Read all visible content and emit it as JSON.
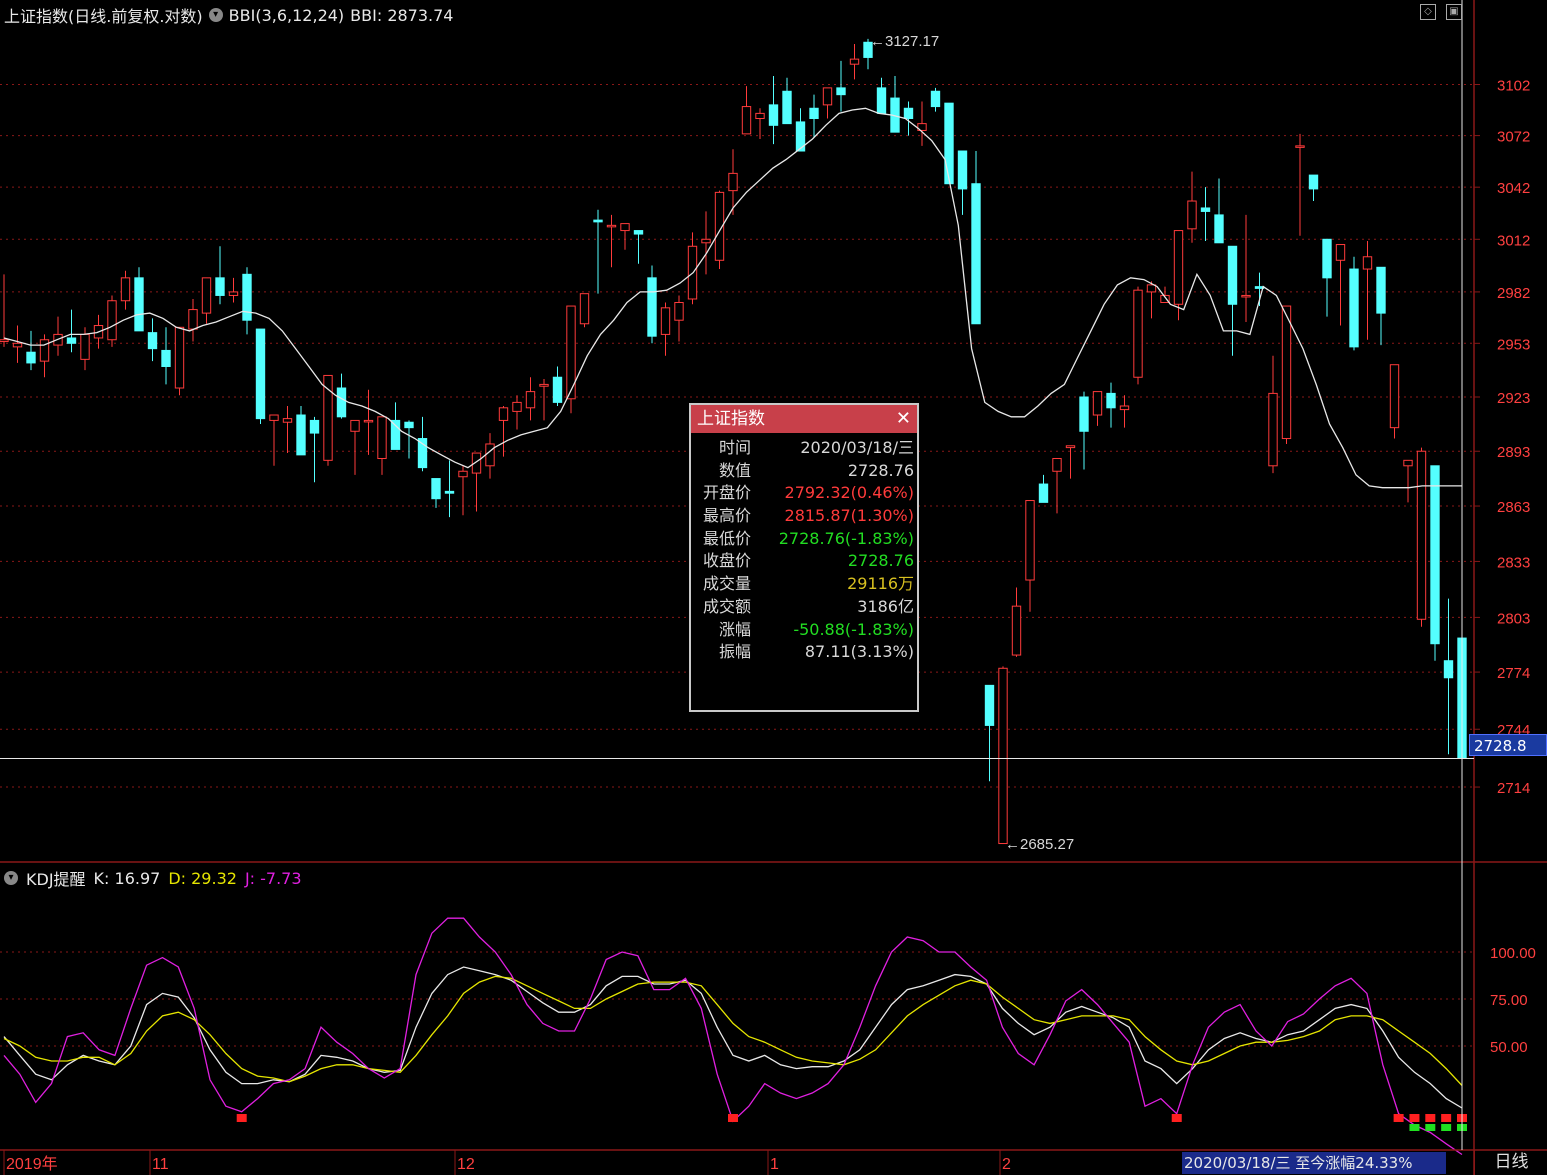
{
  "header": {
    "title": "上证指数(日线.前复权.对数)",
    "indicator_name": "BBI(3,6,12,24)",
    "indicator_value": "BBI: 2873.74"
  },
  "kdj_header": {
    "name": "KDJ提醒",
    "k": "K: 16.97",
    "d": "D: 29.32",
    "j": "J: -7.73"
  },
  "price_axis": {
    "labels": [
      "3102",
      "3072",
      "3042",
      "3012",
      "2982",
      "2953",
      "2923",
      "2893",
      "2863",
      "2833",
      "2803",
      "2774",
      "2744",
      "2714"
    ],
    "current_price": "2728.8"
  },
  "kdj_axis": {
    "labels": [
      "100.00",
      "75.00",
      "50.00"
    ]
  },
  "annotations": {
    "high": "3127.17",
    "low": "2685.27"
  },
  "date_axis": {
    "labels": [
      "2019年",
      "11",
      "12",
      "1",
      "2"
    ]
  },
  "status_bar": {
    "range_text": "2020/03/18/三  至今涨幅24.33%",
    "period_tab": "日线"
  },
  "popup": {
    "title": "上证指数",
    "rows": [
      {
        "label": "时间",
        "value": "2020/03/18/三",
        "color": "#d8d8d8"
      },
      {
        "label": "数值",
        "value": "2728.76",
        "color": "#d8d8d8"
      },
      {
        "label": "开盘价",
        "value": "2792.32(0.46%)",
        "color": "#ff3b3b"
      },
      {
        "label": "最高价",
        "value": "2815.87(1.30%)",
        "color": "#ff3b3b"
      },
      {
        "label": "最低价",
        "value": "2728.76(-1.83%)",
        "color": "#22dd22"
      },
      {
        "label": "收盘价",
        "value": "2728.76",
        "color": "#22dd22"
      },
      {
        "label": "成交量",
        "value": "29116万",
        "color": "#d8c020"
      },
      {
        "label": "成交额",
        "value": "3186亿",
        "color": "#d8d8d8"
      },
      {
        "label": "涨幅",
        "value": "-50.88(-1.83%)",
        "color": "#22dd22"
      },
      {
        "label": "振幅",
        "value": "87.11(3.13%)",
        "color": "#d8d8d8"
      }
    ]
  },
  "colors": {
    "up": "#ff3b3b",
    "down": "#54ffff",
    "bbi": "#e8e8e8",
    "k_line": "#e8e8e8",
    "d_line": "#e5e500",
    "j_line": "#e020e0",
    "grid": "#8a1818"
  },
  "chart_data": {
    "type": "candlestick",
    "title": "上证指数(日线.前复权.对数)",
    "ylim": [
      2685.27,
      3127.17
    ],
    "candles": [
      [
        2954,
        2992,
        2951,
        2955
      ],
      [
        2951,
        2963,
        2942,
        2953
      ],
      [
        2948,
        2960,
        2938,
        2942
      ],
      [
        2943,
        2958,
        2934,
        2955
      ],
      [
        2952,
        2968,
        2946,
        2958
      ],
      [
        2956,
        2972,
        2948,
        2953
      ],
      [
        2944,
        2962,
        2938,
        2958
      ],
      [
        2956,
        2969,
        2950,
        2963
      ],
      [
        2955,
        2980,
        2951,
        2977
      ],
      [
        2977,
        2994,
        2972,
        2990
      ],
      [
        2990,
        2996,
        2964,
        2960
      ],
      [
        2959,
        2967,
        2943,
        2950
      ],
      [
        2949,
        2962,
        2930,
        2940
      ],
      [
        2928,
        2958,
        2924,
        2962
      ],
      [
        2961,
        2978,
        2954,
        2972
      ],
      [
        2970,
        2990,
        2964,
        2990
      ],
      [
        2990,
        3008,
        2975,
        2980
      ],
      [
        2980,
        2990,
        2976,
        2982
      ],
      [
        2992,
        2996,
        2958,
        2966
      ],
      [
        2961,
        2960,
        2908,
        2911
      ],
      [
        2910,
        2913,
        2885,
        2913
      ],
      [
        2909,
        2918,
        2892,
        2911
      ],
      [
        2913,
        2918,
        2893,
        2891
      ],
      [
        2910,
        2912,
        2876,
        2903
      ],
      [
        2888,
        2930,
        2885,
        2935
      ],
      [
        2928,
        2936,
        2911,
        2912
      ],
      [
        2904,
        2908,
        2880,
        2910
      ],
      [
        2910,
        2927,
        2891,
        2910
      ],
      [
        2889,
        2900,
        2880,
        2912
      ],
      [
        2910,
        2920,
        2896,
        2894
      ],
      [
        2909,
        2910,
        2889,
        2906
      ],
      [
        2900,
        2912,
        2882,
        2884
      ],
      [
        2878,
        2876,
        2862,
        2867
      ],
      [
        2871,
        2888,
        2857,
        2870
      ],
      [
        2879,
        2885,
        2858,
        2882
      ],
      [
        2881,
        2879,
        2860,
        2892
      ],
      [
        2885,
        2903,
        2878,
        2897
      ],
      [
        2910,
        2918,
        2890,
        2917
      ],
      [
        2915,
        2924,
        2905,
        2920
      ],
      [
        2917,
        2934,
        2910,
        2926
      ],
      [
        2929,
        2933,
        2910,
        2930
      ],
      [
        2934,
        2940,
        2918,
        2920
      ],
      [
        2922,
        2951,
        2914,
        2974
      ],
      [
        2964,
        2980,
        2962,
        2981
      ],
      [
        3023,
        3029,
        2981,
        3022
      ],
      [
        3020,
        3026,
        2996,
        3020
      ],
      [
        3017,
        3021,
        3006,
        3021
      ],
      [
        3017,
        3015,
        2998,
        3015
      ],
      [
        2990,
        2997,
        2953,
        2957
      ],
      [
        2958,
        2976,
        2946,
        2973
      ],
      [
        2966,
        2980,
        2954,
        2976
      ],
      [
        2978,
        3016,
        2975,
        3008
      ],
      [
        3010,
        3028,
        2992,
        3012
      ],
      [
        3000,
        3040,
        2995,
        3039
      ],
      [
        3040,
        3064,
        3026,
        3050
      ],
      [
        3073,
        3101,
        3074,
        3089
      ],
      [
        3082,
        3088,
        3070,
        3085
      ],
      [
        3090,
        3107,
        3067,
        3078
      ],
      [
        3098,
        3106,
        3080,
        3079
      ],
      [
        3080,
        3088,
        3065,
        3063
      ],
      [
        3088,
        3096,
        3071,
        3082
      ],
      [
        3090,
        3086,
        3082,
        3100
      ],
      [
        3100,
        3116,
        3086,
        3096
      ],
      [
        3114,
        3126,
        3105,
        3117
      ],
      [
        3127,
        3129,
        3111,
        3118
      ],
      [
        3100,
        3106,
        3092,
        3085
      ],
      [
        3094,
        3107,
        3081,
        3074
      ],
      [
        3088,
        3092,
        3072,
        3082
      ],
      [
        3075,
        3092,
        3066,
        3079
      ],
      [
        3098,
        3100,
        3086,
        3089
      ],
      [
        3091,
        3087,
        3044,
        3044
      ],
      [
        3063,
        3052,
        3026,
        3041
      ],
      [
        3044,
        3063,
        2967,
        2964
      ],
      [
        2767,
        2767,
        2717,
        2746
      ],
      [
        2685,
        2777,
        2685,
        2776
      ],
      [
        2783,
        2819,
        2782,
        2809
      ],
      [
        2823,
        2853,
        2806,
        2866
      ],
      [
        2875,
        2880,
        2868,
        2865
      ],
      [
        2882,
        2885,
        2859,
        2889
      ],
      [
        2895,
        2896,
        2878,
        2896
      ],
      [
        2923,
        2926,
        2883,
        2904
      ],
      [
        2913,
        2925,
        2907,
        2926
      ],
      [
        2925,
        2931,
        2906,
        2917
      ],
      [
        2916,
        2924,
        2906,
        2918
      ],
      [
        2934,
        2985,
        2930,
        2983
      ],
      [
        2982,
        2988,
        2967,
        2986
      ],
      [
        2976,
        2985,
        2982,
        2980
      ],
      [
        2975,
        2991,
        2966,
        3017
      ],
      [
        3018,
        3051,
        3010,
        3034
      ],
      [
        3030,
        3042,
        3011,
        3028
      ],
      [
        3026,
        3047,
        3018,
        3010
      ],
      [
        3008,
        3002,
        2946,
        2975
      ],
      [
        2980,
        3026,
        2965,
        2980
      ],
      [
        2985,
        2993,
        2974,
        2984
      ],
      [
        2885,
        2946,
        2881,
        2925
      ],
      [
        2900,
        2962,
        2897,
        2974
      ],
      [
        3066,
        3073,
        3014,
        3066
      ],
      [
        3049,
        3038,
        3034,
        3041
      ],
      [
        3012,
        3008,
        2968,
        2990
      ],
      [
        3000,
        2998,
        2963,
        3009
      ],
      [
        2995,
        3002,
        2949,
        2951
      ],
      [
        2995,
        3011,
        2955,
        3002
      ],
      [
        2996,
        2980,
        2952,
        2970
      ],
      [
        2906,
        2936,
        2900,
        2941
      ],
      [
        2885,
        2881,
        2865,
        2888
      ],
      [
        2802,
        2895,
        2798,
        2893
      ],
      [
        2885,
        2825,
        2780,
        2789
      ],
      [
        2780,
        2813,
        2731,
        2771
      ],
      [
        2792,
        2816,
        2729,
        2729
      ]
    ],
    "bbi": [
      2956,
      2954,
      2952,
      2952,
      2955,
      2958,
      2958,
      2959,
      2962,
      2966,
      2969,
      2970,
      2967,
      2962,
      2960,
      2963,
      2965,
      2968,
      2971,
      2970,
      2967,
      2960,
      2950,
      2940,
      2930,
      2924,
      2920,
      2918,
      2915,
      2911,
      2904,
      2900,
      2895,
      2891,
      2887,
      2884,
      2889,
      2895,
      2899,
      2902,
      2904,
      2906,
      2915,
      2930,
      2946,
      2958,
      2966,
      2976,
      2982,
      2982,
      2983,
      2987,
      2993,
      3004,
      3017,
      3030,
      3039,
      3046,
      3053,
      3058,
      3064,
      3070,
      3078,
      3085,
      3087,
      3088,
      3085,
      3084,
      3082,
      3076,
      3069,
      3058,
      3020,
      2950,
      2920,
      2915,
      2912,
      2912,
      2918,
      2925,
      2930,
      2945,
      2960,
      2975,
      2986,
      2990,
      2989,
      2985,
      2975,
      2972,
      2992,
      2980,
      2960,
      2960,
      2958,
      2985,
      2980,
      2965,
      2950,
      2930,
      2908,
      2895,
      2880,
      2874,
      2873,
      2873,
      2873,
      2874,
      2874,
      2874,
      2874
    ],
    "kdj": {
      "K": [
        55,
        45,
        35,
        32,
        40,
        45,
        42,
        40,
        50,
        72,
        78,
        76,
        65,
        48,
        36,
        30,
        30,
        32,
        31,
        35,
        45,
        44,
        42,
        38,
        36,
        37,
        60,
        78,
        88,
        92,
        90,
        88,
        85,
        79,
        73,
        68,
        68,
        72,
        82,
        87,
        87,
        83,
        83,
        85,
        78,
        60,
        45,
        42,
        45,
        40,
        38,
        39,
        39,
        42,
        48,
        60,
        72,
        80,
        82,
        85,
        88,
        87,
        83,
        70,
        62,
        56,
        60,
        68,
        71,
        68,
        65,
        60,
        42,
        38,
        30,
        38,
        48,
        54,
        57,
        54,
        52,
        56,
        58,
        64,
        70,
        72,
        70,
        58,
        44,
        36,
        30,
        22,
        17
      ],
      "D": [
        54,
        50,
        44,
        42,
        42,
        44,
        44,
        40,
        46,
        58,
        66,
        68,
        64,
        56,
        46,
        38,
        34,
        33,
        31,
        34,
        38,
        40,
        40,
        38,
        37,
        36,
        45,
        56,
        66,
        78,
        84,
        87,
        86,
        82,
        78,
        74,
        70,
        70,
        75,
        79,
        83,
        84,
        84,
        84,
        82,
        72,
        62,
        55,
        52,
        48,
        44,
        42,
        41,
        40,
        43,
        48,
        57,
        66,
        72,
        77,
        82,
        85,
        83,
        76,
        70,
        64,
        62,
        64,
        66,
        66,
        66,
        64,
        55,
        48,
        42,
        40,
        42,
        46,
        50,
        52,
        52,
        53,
        55,
        58,
        64,
        66,
        66,
        64,
        58,
        52,
        46,
        38,
        29
      ],
      "J": [
        45,
        35,
        20,
        30,
        55,
        57,
        48,
        45,
        70,
        93,
        97,
        92,
        70,
        32,
        18,
        15,
        22,
        30,
        32,
        38,
        60,
        52,
        46,
        38,
        33,
        38,
        88,
        110,
        118,
        118,
        108,
        100,
        88,
        72,
        62,
        58,
        58,
        75,
        96,
        100,
        98,
        80,
        80,
        86,
        70,
        35,
        10,
        18,
        30,
        25,
        22,
        25,
        30,
        40,
        60,
        82,
        100,
        108,
        106,
        100,
        100,
        92,
        85,
        60,
        46,
        40,
        56,
        74,
        80,
        72,
        62,
        52,
        18,
        22,
        14,
        40,
        60,
        68,
        72,
        58,
        50,
        63,
        67,
        75,
        82,
        86,
        78,
        40,
        14,
        8,
        4,
        -2,
        -7.73
      ]
    }
  }
}
